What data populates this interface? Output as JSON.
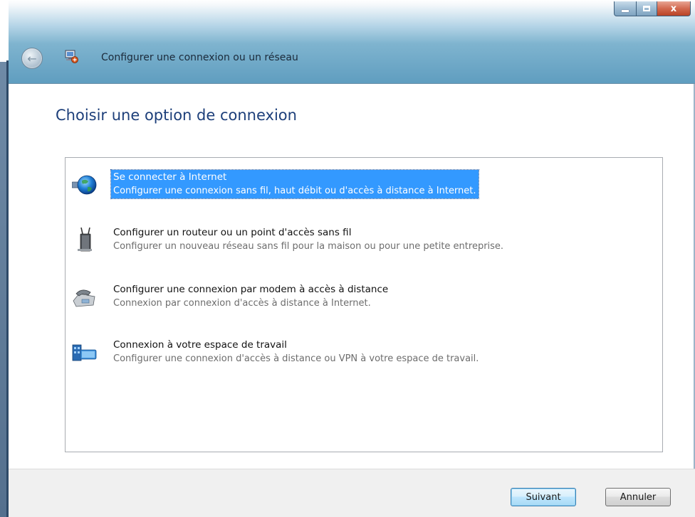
{
  "window": {
    "title": "Configurer une connexion ou un réseau",
    "controls": {
      "minimize": "minimize-icon",
      "maximize": "maximize-icon",
      "close": "x"
    }
  },
  "main": {
    "heading": "Choisir une option de connexion",
    "options": [
      {
        "title": "Se connecter à Internet",
        "description": "Configurer une connexion sans fil, haut débit ou d'accès à distance à Internet.",
        "icon": "globe-network-icon",
        "selected": true
      },
      {
        "title": "Configurer un routeur ou un point d'accès sans fil",
        "description": "Configurer un nouveau réseau sans fil pour la maison ou pour une petite entreprise.",
        "icon": "wireless-router-icon",
        "selected": false
      },
      {
        "title": "Configurer une connexion par modem à accès à distance",
        "description": "Connexion par connexion d'accès à distance à Internet.",
        "icon": "dialup-modem-icon",
        "selected": false
      },
      {
        "title": "Connexion à votre espace de travail",
        "description": "Configurer une connexion d'accès à distance ou VPN à votre espace de travail.",
        "icon": "workplace-vpn-icon",
        "selected": false
      }
    ]
  },
  "footer": {
    "next_label": "Suivant",
    "cancel_label": "Annuler"
  },
  "colors": {
    "selection": "#3399ff",
    "heading": "#1d3f7a",
    "description": "#6d6d6d"
  }
}
